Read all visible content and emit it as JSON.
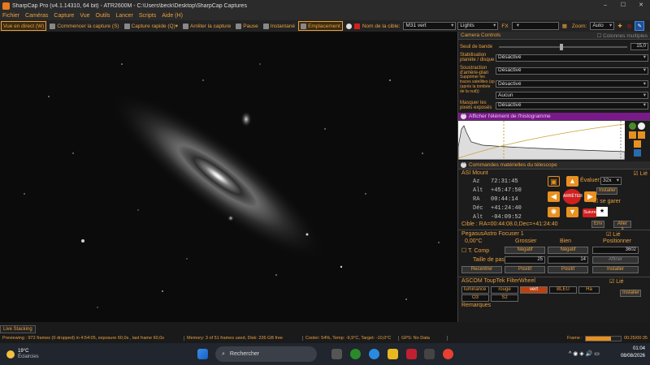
{
  "window": {
    "title": "SharpCap Pro (v4.1.14310, 64 bit) - ATR2600M - C:\\Users\\beck\\Desktop\\SharpCap Captures"
  },
  "menu": [
    "Fichier",
    "Caméras",
    "Capture",
    "Vue",
    "Outils",
    "Lancer",
    "Scripts",
    "Aide (H)"
  ],
  "toolbar": {
    "live": "Vue en direct (W)",
    "start": "Commencer la capture (S)",
    "quick": "Capture rapide (Q)",
    "stop": "Arrêter la capture",
    "pause": "Pause",
    "snapshot": "Instantané",
    "placement": "Emplacement",
    "target_label": "Nom de la cible:",
    "target": "M31 vert",
    "lights": "Lights",
    "fx": "FX",
    "zoom_label": "Zoom:",
    "zoom": "Auto"
  },
  "camera_controls": {
    "header": "Camera Controls",
    "multi": "Colonnes multiples",
    "threshold_label": "Seuil de bande",
    "threshold_value": "15,0",
    "rows": [
      {
        "label": "Stabilisation planète / disque",
        "value": "Désactivé"
      },
      {
        "label": "Soustraction d'arrière-plan",
        "value": "Désactivé"
      },
      {
        "label": "Supprimer les traces satellites (sp (après la tombée de la nuit))",
        "value": "Désactivé"
      },
      {
        "label": "",
        "value": "Aucun"
      },
      {
        "label": "Masquer les pixels exposés",
        "value": "Désactivé"
      }
    ]
  },
  "histogram": {
    "header": "Afficher l'élément de l'histogramme"
  },
  "telescope": {
    "header": "Commandes matérielles du télescope",
    "mount": "ASI Mount",
    "linked": "Lié",
    "coords": [
      {
        "k": "Az",
        "v": "72:31:45"
      },
      {
        "k": "Alt",
        "v": "+45:47:50"
      },
      {
        "k": "RA",
        "v": "00:44:14"
      },
      {
        "k": "Déc",
        "v": "+41:24:40"
      },
      {
        "k": "Alt",
        "v": "-04:09:52"
      }
    ],
    "eval_label": "Évaluer:",
    "eval": "32x",
    "install": "Installer",
    "park": "se garer",
    "stop": "ARRÊTER",
    "follow": "Suivre",
    "target": "Cible : RA=00:44:08.0,Dec=+41:24:40",
    "env": "Env",
    "goto": "Aller à"
  },
  "focuser": {
    "name": "PegasusAstro Focuser 1",
    "linked": "Lié",
    "temp": "0,00°C",
    "coarse": "Grossier",
    "fine": "Bien",
    "position": "Positionner",
    "tcomp": "T. Comp",
    "neg1": "Négatif",
    "neg2": "Négatif",
    "pos_value": "3602",
    "step_label": "Taille de pas",
    "step_coarse": "25",
    "step_fine": "14",
    "confirm": "Affiner",
    "recenter": "Recentrer",
    "pos1": "Positif",
    "pos2": "Positif",
    "install": "Installer"
  },
  "filterwheel": {
    "name": "ASCOM ToupTek FilterWheel",
    "linked": "Lié",
    "filters": [
      "luminance",
      "rouge",
      "vert",
      "BLEU",
      "Ha",
      "O3",
      "S2"
    ],
    "active": "vert",
    "install": "Installer",
    "remarks": "Remarques"
  },
  "live_stacking": "Live Stacking",
  "status": {
    "preview": "Previewing : 972 frames (0 dropped) in 4:54:05, exposure 60,0s , last frame 60,0s",
    "memory": "Memory: 3 of 51 frames used, Disk: 236 GB free",
    "cooler": "Cooler: 54%, Temp: -9,9°C, Target: -10,0°C",
    "gps": "GPS: No Data",
    "frame_label": "Frame :",
    "time": "00:25/00:35"
  },
  "taskbar": {
    "temp": "19°C",
    "weather": "Éclaircies",
    "search": "Rechercher",
    "time": "01:04",
    "date": "08/08/2026"
  },
  "colors": {
    "accent": "#e8a040",
    "purple": "#7a1a8a",
    "red": "#d02020"
  }
}
